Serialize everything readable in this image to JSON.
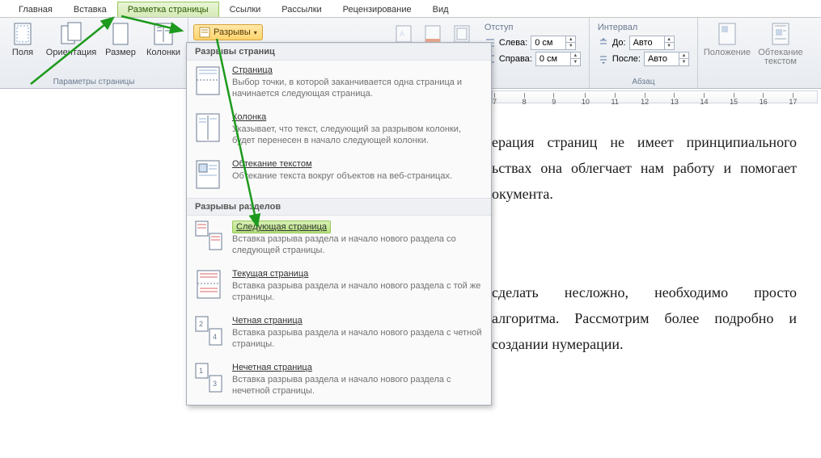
{
  "tabs": {
    "home": "Главная",
    "insert": "Вставка",
    "layout": "Разметка страницы",
    "references": "Ссылки",
    "mailings": "Рассылки",
    "review": "Рецензирование",
    "view": "Вид"
  },
  "ribbon": {
    "margins": "Поля",
    "orientation": "Ориентация",
    "size": "Размер",
    "columns": "Колонки",
    "breaks": "Разрывы",
    "page_setup_group": "Параметры страницы",
    "indent_header": "Отступ",
    "indent_left_label": "Слева:",
    "indent_right_label": "Справа:",
    "indent_left_value": "0 см",
    "indent_right_value": "0 см",
    "spacing_header": "Интервал",
    "spacing_before_label": "До:",
    "spacing_after_label": "После:",
    "spacing_before_value": "Авто",
    "spacing_after_value": "Авто",
    "paragraph_group": "Абзац",
    "position": "Положение",
    "wrap": "Обтекание текстом"
  },
  "dropdown": {
    "section_page": "Разрывы страниц",
    "item_page_title": "Страница",
    "item_page_desc": "Выбор точки, в которой заканчивается одна страница и начинается следующая страница.",
    "item_column_title": "Колонка",
    "item_column_desc": "Указывает, что текст, следующий за разрывом колонки, будет перенесен в начало следующей колонки.",
    "item_wrap_title": "Обтекание текстом",
    "item_wrap_desc": "Обтекание текста вокруг объектов на веб-страницах.",
    "section_break": "Разрывы разделов",
    "item_next_title": "Следующая страница",
    "item_next_desc": "Вставка разрыва раздела и начало нового раздела со следующей страницы.",
    "item_current_title": "Текущая страница",
    "item_current_desc": "Вставка разрыва раздела и начало нового раздела с той же страницы.",
    "item_even_title": "Четная страница",
    "item_even_desc": "Вставка разрыва раздела и начало нового раздела с четной страницы.",
    "item_odd_title": "Нечетная страница",
    "item_odd_desc": "Вставка разрыва раздела и начало нового раздела с нечетной страницы."
  },
  "ruler": {
    "marks": [
      "7",
      "8",
      "9",
      "10",
      "11",
      "12",
      "13",
      "14",
      "15",
      "16",
      "17"
    ]
  },
  "document": {
    "p1": "ерация страниц не имеет принципиального ьствах она облегчает нам работу и помогает окумента.",
    "p2": "сделать несложно, необходимо просто алгоритма. Рассмотрим более подробно и создании нумерации."
  }
}
